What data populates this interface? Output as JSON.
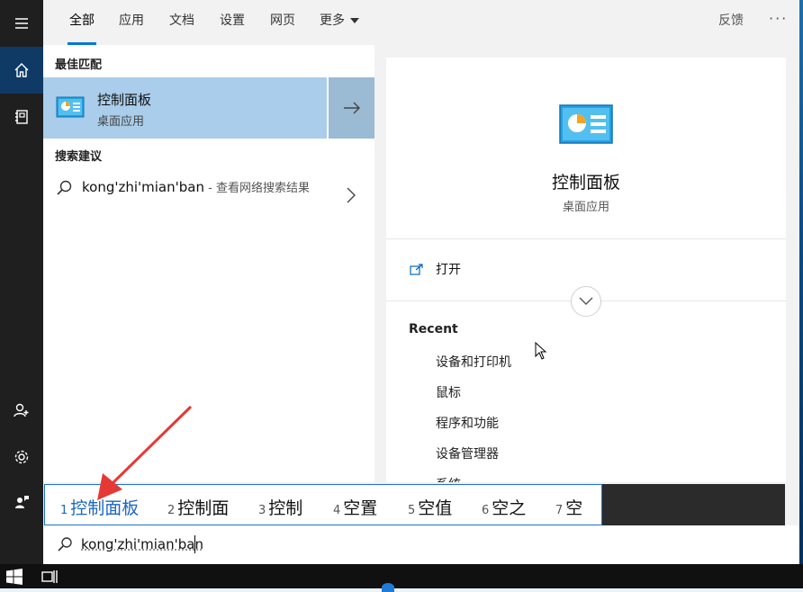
{
  "tabs": [
    {
      "label": "全部"
    },
    {
      "label": "应用"
    },
    {
      "label": "文档"
    },
    {
      "label": "设置"
    },
    {
      "label": "网页"
    },
    {
      "label": "更多"
    }
  ],
  "header": {
    "feedback_label": "反馈",
    "more_options": "···"
  },
  "results": {
    "best_match_title": "最佳匹配",
    "best_match": {
      "title": "控制面板",
      "subtitle": "桌面应用",
      "icon": "control-panel-icon"
    },
    "suggestions_title": "搜索建议",
    "suggestion": {
      "query": "kong'zhi'mian'ban",
      "separator": " - ",
      "action": "查看网络搜索结果"
    }
  },
  "preview": {
    "title": "控制面板",
    "subtitle": "桌面应用",
    "open_label": "打开",
    "recent_title": "Recent",
    "recent_items": [
      "设备和打印机",
      "鼠标",
      "程序和功能",
      "设备管理器",
      "系统"
    ]
  },
  "ime": {
    "candidates": [
      {
        "num": "1",
        "text": "控制面板"
      },
      {
        "num": "2",
        "text": "控制面"
      },
      {
        "num": "3",
        "text": "控制"
      },
      {
        "num": "4",
        "text": "空置"
      },
      {
        "num": "5",
        "text": "空值"
      },
      {
        "num": "6",
        "text": "空之"
      },
      {
        "num": "7",
        "text": "空"
      }
    ]
  },
  "search": {
    "value": "kong'zhi'mian'ban"
  },
  "colors": {
    "accent": "#0078d7",
    "selection": "#a9cdea",
    "annotation": "#e53935"
  }
}
